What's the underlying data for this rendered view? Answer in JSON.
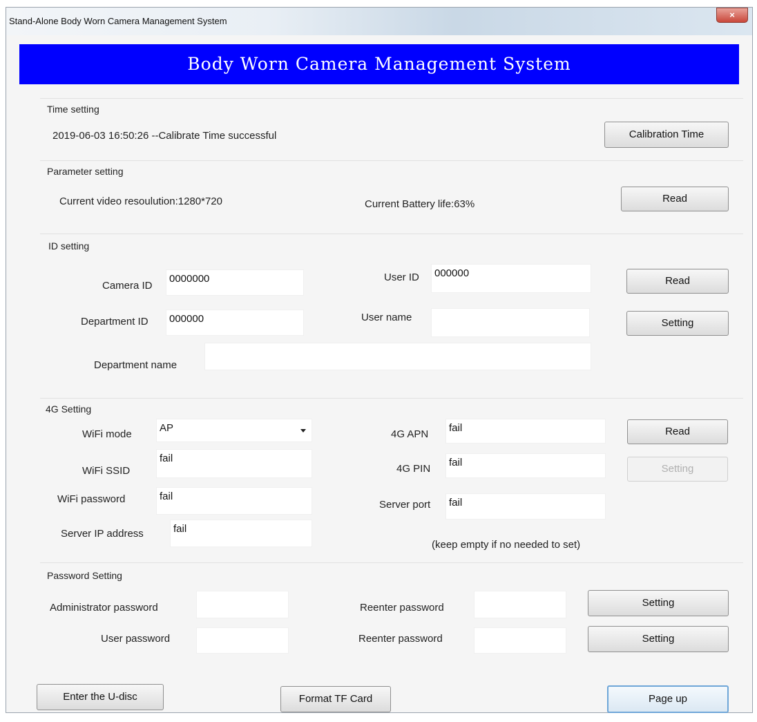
{
  "window": {
    "title": "Stand-Alone Body Worn Camera Management System",
    "close_icon": "close-icon",
    "close_glyph": "×"
  },
  "banner": {
    "title": "Body Worn Camera Management System"
  },
  "time_setting": {
    "title": "Time setting",
    "status": "2019-06-03 16:50:26 --Calibrate Time successful",
    "calibrate_button": "Calibration Time"
  },
  "parameter_setting": {
    "title": "Parameter setting",
    "video_resolution": "Current video resoulution:1280*720",
    "battery_life": "Current Battery life:63%",
    "read_button": "Read"
  },
  "id_setting": {
    "title": "ID setting",
    "camera_id_label": "Camera ID",
    "camera_id_value": "0000000",
    "user_id_label": "User ID",
    "user_id_value": "000000",
    "department_id_label": "Department ID",
    "department_id_value": "000000",
    "user_name_label": "User name",
    "user_name_value": "",
    "department_name_label": "Department name",
    "department_name_value": "",
    "read_button": "Read",
    "setting_button": "Setting"
  },
  "g4_setting": {
    "title": "4G Setting",
    "wifi_mode_label": "WiFi mode",
    "wifi_mode_value": "AP",
    "wifi_ssid_label": "WiFi SSID",
    "wifi_ssid_value": "fail",
    "wifi_password_label": "WiFi password",
    "wifi_password_value": "fail",
    "server_ip_label": "Server IP address",
    "server_ip_value": "fail",
    "apn_label": "4G APN",
    "apn_value": "fail",
    "pin_label": "4G PIN",
    "pin_value": "fail",
    "server_port_label": "Server port",
    "server_port_value": "fail",
    "hint": "(keep empty if no needed to set)",
    "read_button": "Read",
    "setting_button": "Setting"
  },
  "password_setting": {
    "title": "Password Setting",
    "admin_label": "Administrator password",
    "user_label": "User password",
    "reenter_label_1": "Reenter password",
    "reenter_label_2": "Reenter password",
    "setting_button_1": "Setting",
    "setting_button_2": "Setting"
  },
  "footer": {
    "udisc_button": "Enter the U-disc",
    "format_button": "Format TF Card",
    "pageup_button": "Page up"
  }
}
